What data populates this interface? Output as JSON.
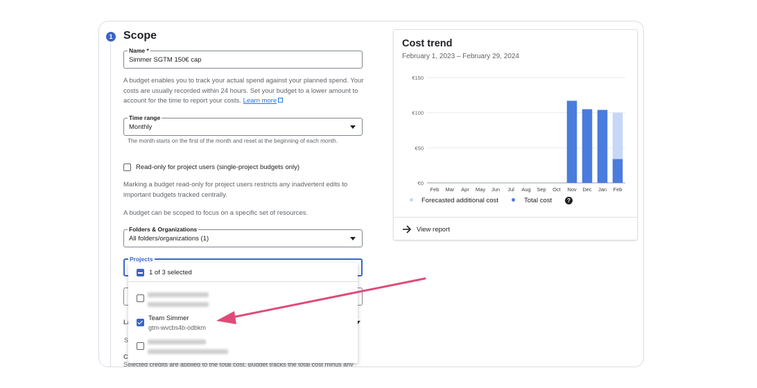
{
  "scope": {
    "step_number": "1",
    "title": "Scope"
  },
  "name_field": {
    "label": "Name *",
    "value": "Simmer SGTM 150€ cap"
  },
  "description": {
    "text": "A budget enables you to track your actual spend against your planned spend. Your costs are usually recorded within 24 hours. Set your budget to a lower amount to account for the time to report your costs.",
    "link_label": "Learn more"
  },
  "time_range": {
    "label": "Time range",
    "value": "Monthly",
    "helper": "The month starts on the first of the month and reset at the beginning of each month."
  },
  "readonly": {
    "label": "Read-only for project users (single-project budgets only)",
    "checked": false,
    "note": "Marking a budget read-only for project users restricts any inadvertent edits to important budgets tracked centrally."
  },
  "scope_note": "A budget can be scoped to focus on a specific set of resources.",
  "folders": {
    "label": "Folders & Organizations",
    "value": "All folders/organizations (1)"
  },
  "projects": {
    "label": "Projects",
    "selection_summary": "1 of 3 selected",
    "items": [
      {
        "name": "",
        "id": "",
        "checked": false,
        "blurred": true
      },
      {
        "name": "Team Simmer",
        "id": "gtm-wvcbs4b-odbkm",
        "checked": true,
        "blurred": false
      },
      {
        "name": "",
        "id": "",
        "checked": false,
        "blurred": true
      }
    ]
  },
  "partially_hidden": {
    "label_la": "La",
    "label_s": "S",
    "label_cr": "Cr",
    "credits_note": "Selected credits are applied to the total cost. Budget tracks the total cost minus any"
  },
  "cost_trend": {
    "title": "Cost trend",
    "date_range": "February 1, 2023 – February 29, 2024",
    "legend": {
      "forecast_label": "Forecasted additional cost",
      "total_label": "Total cost"
    },
    "view_report_label": "View report"
  },
  "colors": {
    "accent": "#3b65c8",
    "bar_total": "#4a7cde",
    "bar_forecast": "#c6d7f7",
    "annotation_arrow": "#e04a78"
  },
  "chart_data": {
    "type": "bar",
    "categories": [
      "Feb",
      "Mar",
      "Apr",
      "May",
      "Jun",
      "Jul",
      "Aug",
      "Sep",
      "Oct",
      "Nov",
      "Dec",
      "Jan",
      "Feb"
    ],
    "series": [
      {
        "name": "Total cost",
        "values": [
          0,
          0,
          0,
          0,
          0,
          0,
          0,
          0,
          0,
          117,
          105,
          104,
          34
        ]
      },
      {
        "name": "Forecasted additional cost",
        "values": [
          0,
          0,
          0,
          0,
          0,
          0,
          0,
          0,
          0,
          0,
          0,
          0,
          66
        ]
      }
    ],
    "stacked": true,
    "y_ticks": [
      "€150",
      "€100",
      "€50",
      "€0"
    ],
    "ylim": [
      0,
      150
    ],
    "grid": true
  }
}
